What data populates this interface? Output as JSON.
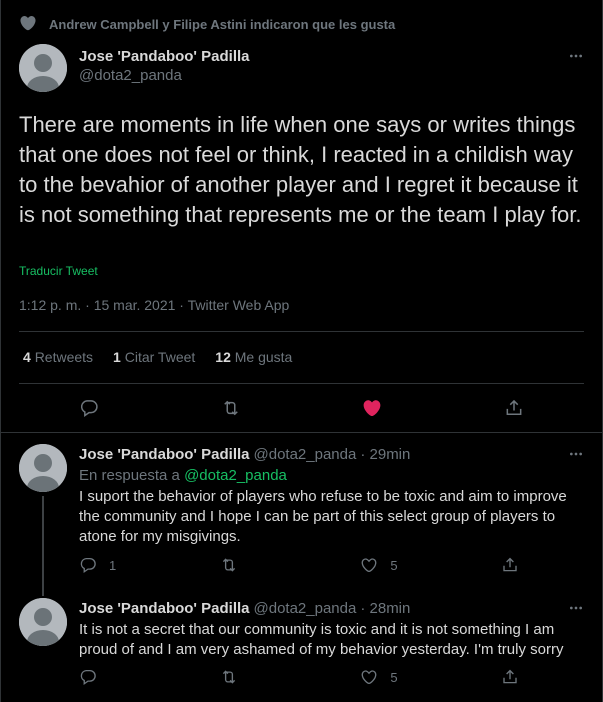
{
  "social_context": {
    "text": "Andrew Campbell y Filipe Astini indicaron que les gusta",
    "icon": "heart-icon"
  },
  "main_tweet": {
    "author_name": "Jose 'Pandaboo' Padilla",
    "author_handle": "@dota2_panda",
    "text": "There are moments in life when one says or writes things that one does not feel or think, I reacted in a childish way to the bevahior of another player and I regret it because it is not something that represents me or the team I play for.",
    "translate_label": "Traducir Tweet",
    "meta": "1:12 p. m. · 15 mar. 2021 · Twitter Web App",
    "stats": {
      "retweets_count": "4",
      "retweets_label": "Retweets",
      "quotes_count": "1",
      "quotes_label": "Citar Tweet",
      "likes_count": "12",
      "likes_label": "Me gusta"
    }
  },
  "replies": [
    {
      "author_name": "Jose 'Pandaboo' Padilla",
      "author_handle": "@dota2_panda",
      "time": "· 29min",
      "reply_to_prefix": "En respuesta a",
      "reply_to_handle": "@dota2_panda",
      "text": "I suport the behavior of players who refuse to be toxic and aim to improve the community and I hope I can be part of this select group of players to atone for my misgivings.",
      "reply_count": "1",
      "retweet_count": "",
      "like_count": "5"
    },
    {
      "author_name": "Jose 'Pandaboo' Padilla",
      "author_handle": "@dota2_panda",
      "time": "· 28min",
      "text": "It is not a secret that our community is toxic and it is not something I am proud of and I am very ashamed of my behavior yesterday. I'm truly sorry",
      "reply_count": "",
      "retweet_count": "",
      "like_count": "5"
    }
  ],
  "colors": {
    "background": "#000000",
    "text": "#d9d9d9",
    "muted": "#6e767d",
    "link_green": "#17bf63",
    "like_red": "#e0245e",
    "divider": "#2f3336"
  }
}
